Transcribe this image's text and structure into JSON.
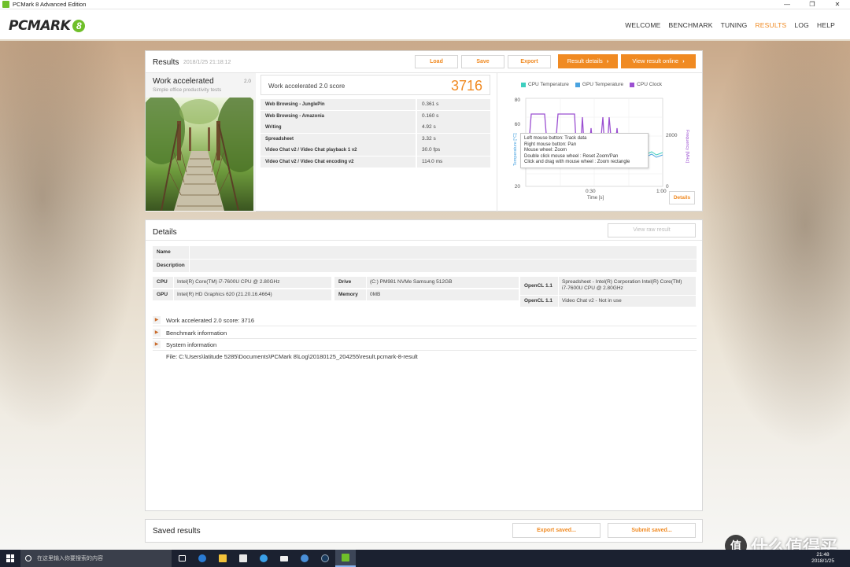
{
  "window": {
    "title": "PCMark 8 Advanced Edition",
    "controls": [
      "—",
      "❐",
      "✕"
    ]
  },
  "header": {
    "logo_text": "PCMARK",
    "logo_badge": "8",
    "nav": [
      {
        "label": "WELCOME",
        "active": false
      },
      {
        "label": "BENCHMARK",
        "active": false
      },
      {
        "label": "TUNING",
        "active": false
      },
      {
        "label": "RESULTS",
        "active": true
      },
      {
        "label": "LOG",
        "active": false
      },
      {
        "label": "HELP",
        "active": false
      }
    ],
    "accent_color": "#f08a22"
  },
  "results": {
    "title": "Results",
    "date": "2018/1/25 21:18:12",
    "buttons": {
      "load": "Load",
      "save": "Save",
      "export": "Export",
      "result_details": "Result details",
      "view_online": "View result online"
    },
    "test": {
      "name": "Work accelerated",
      "version": "2.0",
      "subtitle": "Simple office productivity tests"
    },
    "score_label": "Work accelerated 2.0 score",
    "score_value": "3716",
    "subtests": [
      {
        "name": "Web Browsing - JunglePin",
        "value": "0.361 s"
      },
      {
        "name": "Web Browsing - Amazonia",
        "value": "0.160 s"
      },
      {
        "name": "Writing",
        "value": "4.92 s"
      },
      {
        "name": "Spreadsheet",
        "value": "3.32 s"
      },
      {
        "name": "Video Chat v2 / Video Chat playback 1 v2",
        "value": "30.0 fps"
      },
      {
        "name": "Video Chat v2 / Video Chat encoding v2",
        "value": "114.0 ms"
      }
    ],
    "chart": {
      "legend": [
        {
          "label": "CPU Temperature",
          "color": "#3ecfbf"
        },
        {
          "label": "GPU Temperature",
          "color": "#4aa3e0"
        },
        {
          "label": "CPU Clock",
          "color": "#9b4fd1"
        }
      ],
      "y_left_ticks": [
        "80",
        "60",
        "20"
      ],
      "y_right_ticks": [
        "2000",
        "0"
      ],
      "x_ticks": [
        "0:30",
        "1:00"
      ],
      "xlabel": "Time [s]",
      "ylabel_left": "Temperature [°C]",
      "ylabel_right": "Frequency [MHz]",
      "tooltip": [
        "Left mouse button: Track data",
        "Right mouse button: Pan",
        "Mouse wheel: Zoom",
        "Double click mouse wheel : Reset Zoom/Pan",
        "Click and drag with mouse wheel : Zoom rectangle"
      ],
      "details_button": "Details"
    }
  },
  "details": {
    "title": "Details",
    "view_raw": "View raw result",
    "name_label": "Name",
    "description_label": "Description",
    "cpu_label": "CPU",
    "cpu_value": "Intel(R) Core(TM) i7-7600U CPU @ 2.80GHz",
    "gpu_label": "GPU",
    "gpu_value": "Intel(R) HD Graphics 620 (21.20.16.4664)",
    "drive_label": "Drive",
    "drive_value": "(C:) PM981 NVMe Samsung 512GB",
    "memory_label": "Memory",
    "memory_value": "0MB",
    "opencl1_label": "OpenCL 1.1",
    "opencl1_value_line1": "Spreadsheet - Intel(R) Corporation Intel(R) Core(TM)",
    "opencl1_value_line2": "i7-7600U CPU @ 2.80GHz",
    "opencl2_label": "OpenCL 1.1",
    "opencl2_value": "Video Chat v2 - Not in use",
    "expanders": [
      "Work accelerated 2.0 score: 3716",
      "Benchmark information",
      "System information"
    ],
    "file": "File: C:\\Users\\latitude 5285\\Documents\\PCMark 8\\Log\\20180125_204255\\result.pcmark-8-result"
  },
  "saved": {
    "title": "Saved results",
    "export": "Export saved...",
    "submit": "Submit saved..."
  },
  "taskbar": {
    "search_placeholder": "在这里输入你要搜索的内容",
    "clock_time": "21:48",
    "clock_date": "2018/1/25"
  },
  "watermark": {
    "badge": "值",
    "text": "什么值得买"
  }
}
